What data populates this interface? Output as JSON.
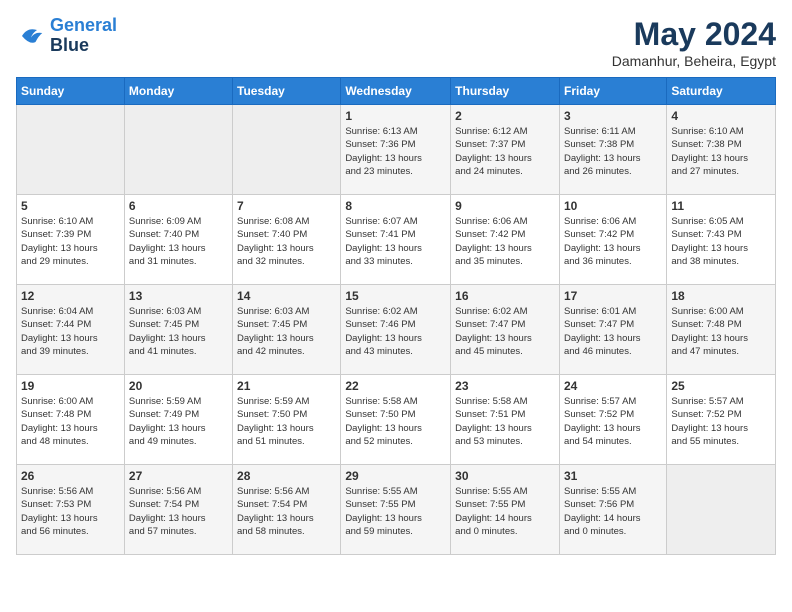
{
  "header": {
    "logo_line1": "General",
    "logo_line2": "Blue",
    "month": "May 2024",
    "location": "Damanhur, Beheira, Egypt"
  },
  "columns": [
    "Sunday",
    "Monday",
    "Tuesday",
    "Wednesday",
    "Thursday",
    "Friday",
    "Saturday"
  ],
  "weeks": [
    [
      {
        "day": "",
        "info": ""
      },
      {
        "day": "",
        "info": ""
      },
      {
        "day": "",
        "info": ""
      },
      {
        "day": "1",
        "info": "Sunrise: 6:13 AM\nSunset: 7:36 PM\nDaylight: 13 hours\nand 23 minutes."
      },
      {
        "day": "2",
        "info": "Sunrise: 6:12 AM\nSunset: 7:37 PM\nDaylight: 13 hours\nand 24 minutes."
      },
      {
        "day": "3",
        "info": "Sunrise: 6:11 AM\nSunset: 7:38 PM\nDaylight: 13 hours\nand 26 minutes."
      },
      {
        "day": "4",
        "info": "Sunrise: 6:10 AM\nSunset: 7:38 PM\nDaylight: 13 hours\nand 27 minutes."
      }
    ],
    [
      {
        "day": "5",
        "info": "Sunrise: 6:10 AM\nSunset: 7:39 PM\nDaylight: 13 hours\nand 29 minutes."
      },
      {
        "day": "6",
        "info": "Sunrise: 6:09 AM\nSunset: 7:40 PM\nDaylight: 13 hours\nand 31 minutes."
      },
      {
        "day": "7",
        "info": "Sunrise: 6:08 AM\nSunset: 7:40 PM\nDaylight: 13 hours\nand 32 minutes."
      },
      {
        "day": "8",
        "info": "Sunrise: 6:07 AM\nSunset: 7:41 PM\nDaylight: 13 hours\nand 33 minutes."
      },
      {
        "day": "9",
        "info": "Sunrise: 6:06 AM\nSunset: 7:42 PM\nDaylight: 13 hours\nand 35 minutes."
      },
      {
        "day": "10",
        "info": "Sunrise: 6:06 AM\nSunset: 7:42 PM\nDaylight: 13 hours\nand 36 minutes."
      },
      {
        "day": "11",
        "info": "Sunrise: 6:05 AM\nSunset: 7:43 PM\nDaylight: 13 hours\nand 38 minutes."
      }
    ],
    [
      {
        "day": "12",
        "info": "Sunrise: 6:04 AM\nSunset: 7:44 PM\nDaylight: 13 hours\nand 39 minutes."
      },
      {
        "day": "13",
        "info": "Sunrise: 6:03 AM\nSunset: 7:45 PM\nDaylight: 13 hours\nand 41 minutes."
      },
      {
        "day": "14",
        "info": "Sunrise: 6:03 AM\nSunset: 7:45 PM\nDaylight: 13 hours\nand 42 minutes."
      },
      {
        "day": "15",
        "info": "Sunrise: 6:02 AM\nSunset: 7:46 PM\nDaylight: 13 hours\nand 43 minutes."
      },
      {
        "day": "16",
        "info": "Sunrise: 6:02 AM\nSunset: 7:47 PM\nDaylight: 13 hours\nand 45 minutes."
      },
      {
        "day": "17",
        "info": "Sunrise: 6:01 AM\nSunset: 7:47 PM\nDaylight: 13 hours\nand 46 minutes."
      },
      {
        "day": "18",
        "info": "Sunrise: 6:00 AM\nSunset: 7:48 PM\nDaylight: 13 hours\nand 47 minutes."
      }
    ],
    [
      {
        "day": "19",
        "info": "Sunrise: 6:00 AM\nSunset: 7:48 PM\nDaylight: 13 hours\nand 48 minutes."
      },
      {
        "day": "20",
        "info": "Sunrise: 5:59 AM\nSunset: 7:49 PM\nDaylight: 13 hours\nand 49 minutes."
      },
      {
        "day": "21",
        "info": "Sunrise: 5:59 AM\nSunset: 7:50 PM\nDaylight: 13 hours\nand 51 minutes."
      },
      {
        "day": "22",
        "info": "Sunrise: 5:58 AM\nSunset: 7:50 PM\nDaylight: 13 hours\nand 52 minutes."
      },
      {
        "day": "23",
        "info": "Sunrise: 5:58 AM\nSunset: 7:51 PM\nDaylight: 13 hours\nand 53 minutes."
      },
      {
        "day": "24",
        "info": "Sunrise: 5:57 AM\nSunset: 7:52 PM\nDaylight: 13 hours\nand 54 minutes."
      },
      {
        "day": "25",
        "info": "Sunrise: 5:57 AM\nSunset: 7:52 PM\nDaylight: 13 hours\nand 55 minutes."
      }
    ],
    [
      {
        "day": "26",
        "info": "Sunrise: 5:56 AM\nSunset: 7:53 PM\nDaylight: 13 hours\nand 56 minutes."
      },
      {
        "day": "27",
        "info": "Sunrise: 5:56 AM\nSunset: 7:54 PM\nDaylight: 13 hours\nand 57 minutes."
      },
      {
        "day": "28",
        "info": "Sunrise: 5:56 AM\nSunset: 7:54 PM\nDaylight: 13 hours\nand 58 minutes."
      },
      {
        "day": "29",
        "info": "Sunrise: 5:55 AM\nSunset: 7:55 PM\nDaylight: 13 hours\nand 59 minutes."
      },
      {
        "day": "30",
        "info": "Sunrise: 5:55 AM\nSunset: 7:55 PM\nDaylight: 14 hours\nand 0 minutes."
      },
      {
        "day": "31",
        "info": "Sunrise: 5:55 AM\nSunset: 7:56 PM\nDaylight: 14 hours\nand 0 minutes."
      },
      {
        "day": "",
        "info": ""
      }
    ]
  ]
}
